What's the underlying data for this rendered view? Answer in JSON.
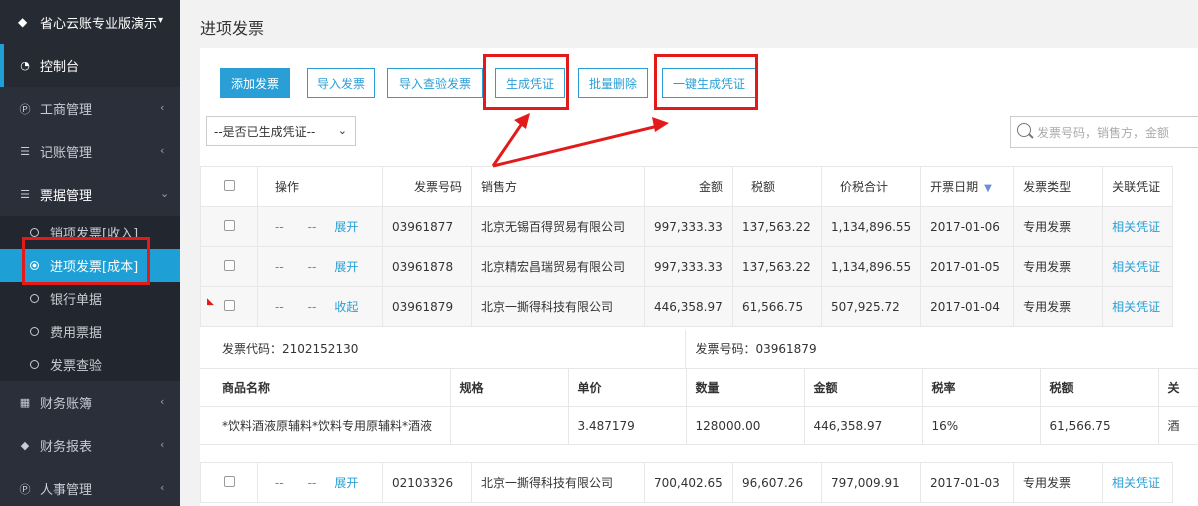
{
  "sidebar": {
    "brand": "省心云账专业版演示",
    "dashboard": "控制台",
    "items": [
      {
        "label": "工商管理"
      },
      {
        "label": "记账管理"
      },
      {
        "label": "票据管理"
      }
    ],
    "sub_items": [
      {
        "label": "销项发票[收入]"
      },
      {
        "label": "进项发票[成本]"
      },
      {
        "label": "银行单据"
      },
      {
        "label": "费用票据"
      },
      {
        "label": "发票查验"
      }
    ],
    "bottom_items": [
      {
        "label": "财务账簿"
      },
      {
        "label": "财务报表"
      },
      {
        "label": "人事管理"
      }
    ]
  },
  "page": {
    "title": "进项发票"
  },
  "toolbar": {
    "add": "添加发票",
    "import": "导入发票",
    "import_verify": "导入查验发票",
    "gen_voucher": "生成凭证",
    "batch_delete": "批量删除",
    "one_click": "一键生成凭证"
  },
  "filter": {
    "select_value": "--是否已生成凭证--",
    "search_placeholder": "发票号码，销售方，金额"
  },
  "table": {
    "headers": [
      "操作",
      "发票号码",
      "销售方",
      "金额",
      "税额",
      "价税合计",
      "开票日期",
      "发票类型",
      "关联凭证"
    ],
    "rows": [
      {
        "a1": "--",
        "a2": "--",
        "toggle": "展开",
        "no": "03961877",
        "seller": "北京无锡百得贸易有限公司",
        "amount": "997,333.33",
        "tax": "137,563.22",
        "total": "1,134,896.55",
        "date": "2017-01-06",
        "type": "专用发票",
        "link": "相关凭证"
      },
      {
        "a1": "--",
        "a2": "--",
        "toggle": "展开",
        "no": "03961878",
        "seller": "北京精宏昌瑞贸易有限公司",
        "amount": "997,333.33",
        "tax": "137,563.22",
        "total": "1,134,896.55",
        "date": "2017-01-05",
        "type": "专用发票",
        "link": "相关凭证"
      },
      {
        "a1": "--",
        "a2": "--",
        "toggle": "收起",
        "no": "03961879",
        "seller": "北京一撕得科技有限公司",
        "amount": "446,358.97",
        "tax": "61,566.75",
        "total": "507,925.72",
        "date": "2017-01-04",
        "type": "专用发票",
        "link": "相关凭证"
      }
    ],
    "last_row": {
      "a1": "--",
      "a2": "--",
      "toggle": "展开",
      "no": "02103326",
      "seller": "北京一撕得科技有限公司",
      "amount": "700,402.65",
      "tax": "96,607.26",
      "total": "797,009.91",
      "date": "2017-01-03",
      "type": "专用发票",
      "link": "相关凭证"
    }
  },
  "detail": {
    "code": "发票代码：2102152130",
    "number": "发票号码：03961879",
    "headers": [
      "商品名称",
      "规格",
      "单价",
      "数量",
      "金额",
      "税率",
      "税额",
      "关"
    ],
    "row": [
      "*饮料酒液原辅料*饮料专用原辅料*酒液",
      "",
      "3.487179",
      "128000.00",
      "446,358.97",
      "16%",
      "61,566.75",
      "酒"
    ]
  },
  "colors": {
    "accent": "#2a9fd6",
    "sidebar": "#2b2f3a",
    "highlight": "#e31a1a"
  }
}
